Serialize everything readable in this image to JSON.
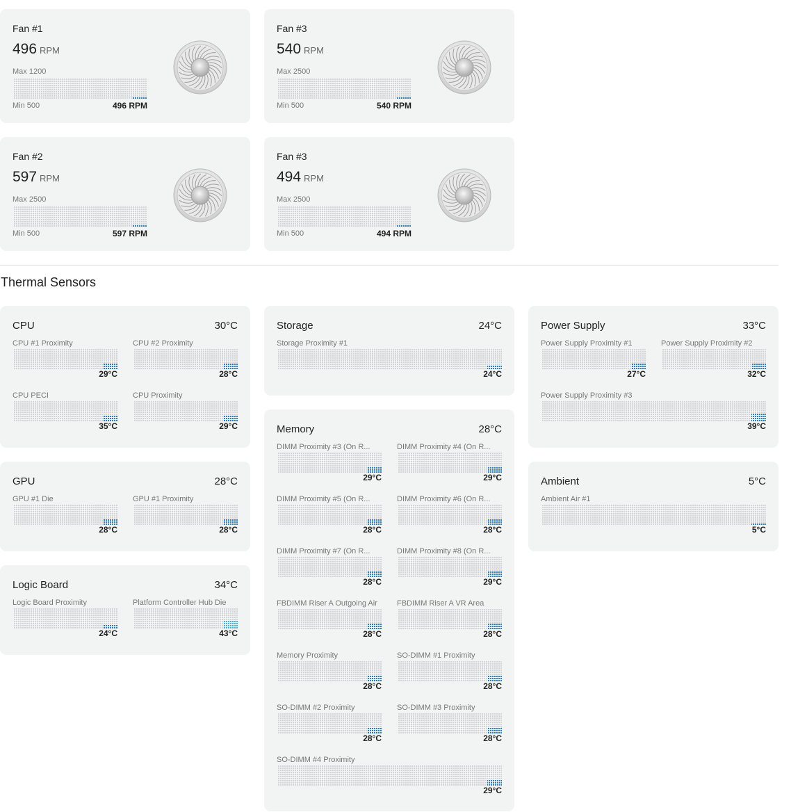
{
  "fans": [
    {
      "name": "Fan #1",
      "rpm": "496",
      "unit": "RPM",
      "max_label": "Max 1200",
      "min_label": "Min 500",
      "value_label": "496 RPM",
      "level": 0.1,
      "max": 1200
    },
    {
      "name": "Fan #3",
      "rpm": "540",
      "unit": "RPM",
      "max_label": "Max 2500",
      "min_label": "Min 500",
      "value_label": "540 RPM",
      "level": 0.05,
      "max": 2500
    },
    {
      "name": "Fan #2",
      "rpm": "597",
      "unit": "RPM",
      "max_label": "Max 2500",
      "min_label": "Min 500",
      "value_label": "597 RPM",
      "level": 0.05,
      "max": 2500
    },
    {
      "name": "Fan #3",
      "rpm": "494",
      "unit": "RPM",
      "max_label": "Max 2500",
      "min_label": "Min 500",
      "value_label": "494 RPM",
      "level": 0.05,
      "max": 2500
    }
  ],
  "section_title": "Thermal Sensors",
  "groups": {
    "cpu": {
      "title": "CPU",
      "temp": "30°C",
      "sensors": [
        {
          "label": "CPU #1 Proximity",
          "value": "29°C",
          "level": 0.29
        },
        {
          "label": "CPU #2 Proximity",
          "value": "28°C",
          "level": 0.28
        },
        {
          "label": "CPU PECI",
          "value": "35°C",
          "level": 0.35
        },
        {
          "label": "CPU Proximity",
          "value": "29°C",
          "level": 0.29
        }
      ]
    },
    "gpu": {
      "title": "GPU",
      "temp": "28°C",
      "sensors": [
        {
          "label": "GPU #1 Die",
          "value": "28°C",
          "level": 0.28
        },
        {
          "label": "GPU #1 Proximity",
          "value": "28°C",
          "level": 0.28
        }
      ]
    },
    "logic": {
      "title": "Logic Board",
      "temp": "34°C",
      "sensors": [
        {
          "label": "Logic Board Proximity",
          "value": "24°C",
          "level": 0.2
        },
        {
          "label": "Platform Controller Hub Die",
          "value": "43°C",
          "level": 0.43,
          "hot": true
        }
      ]
    },
    "storage": {
      "title": "Storage",
      "temp": "24°C",
      "sensors": [
        {
          "label": "Storage Proximity #1",
          "value": "24°C",
          "level": 0.2
        }
      ]
    },
    "memory": {
      "title": "Memory",
      "temp": "28°C",
      "sensors": [
        {
          "label": "DIMM Proximity #3 (On R...",
          "value": "29°C",
          "level": 0.29
        },
        {
          "label": "DIMM Proximity #4 (On R...",
          "value": "29°C",
          "level": 0.29
        },
        {
          "label": "DIMM Proximity #5 (On R...",
          "value": "28°C",
          "level": 0.28
        },
        {
          "label": "DIMM Proximity #6 (On R...",
          "value": "28°C",
          "level": 0.28
        },
        {
          "label": "DIMM Proximity #7 (On R...",
          "value": "28°C",
          "level": 0.28
        },
        {
          "label": "DIMM Proximity #8 (On R...",
          "value": "29°C",
          "level": 0.29
        },
        {
          "label": "FBDIMM Riser A Outgoing Air",
          "value": "28°C",
          "level": 0.28
        },
        {
          "label": "FBDIMM Riser A VR Area",
          "value": "28°C",
          "level": 0.28
        },
        {
          "label": "Memory Proximity",
          "value": "28°C",
          "level": 0.28
        },
        {
          "label": "SO-DIMM #1 Proximity",
          "value": "28°C",
          "level": 0.28
        },
        {
          "label": "SO-DIMM #2 Proximity",
          "value": "28°C",
          "level": 0.28
        },
        {
          "label": "SO-DIMM #3 Proximity",
          "value": "28°C",
          "level": 0.28
        },
        {
          "label": "SO-DIMM #4 Proximity",
          "value": "29°C",
          "level": 0.29
        }
      ]
    },
    "power": {
      "title": "Power Supply",
      "temp": "33°C",
      "sensors": [
        {
          "label": "Power Supply Proximity #1",
          "value": "27°C",
          "level": 0.27
        },
        {
          "label": "Power Supply Proximity #2",
          "value": "32°C",
          "level": 0.32
        },
        {
          "label": "Power Supply Proximity #3",
          "value": "39°C",
          "level": 0.39
        }
      ]
    },
    "ambient": {
      "title": "Ambient",
      "temp": "5°C",
      "sensors": [
        {
          "label": "Ambient Air #1",
          "value": "5°C",
          "level": 0.05
        }
      ]
    }
  },
  "colors": {
    "card": "#f2f3f3",
    "bar": "#2a7fd4",
    "bar_hot": "#3fb6e8",
    "dot": "#c9cccf"
  }
}
